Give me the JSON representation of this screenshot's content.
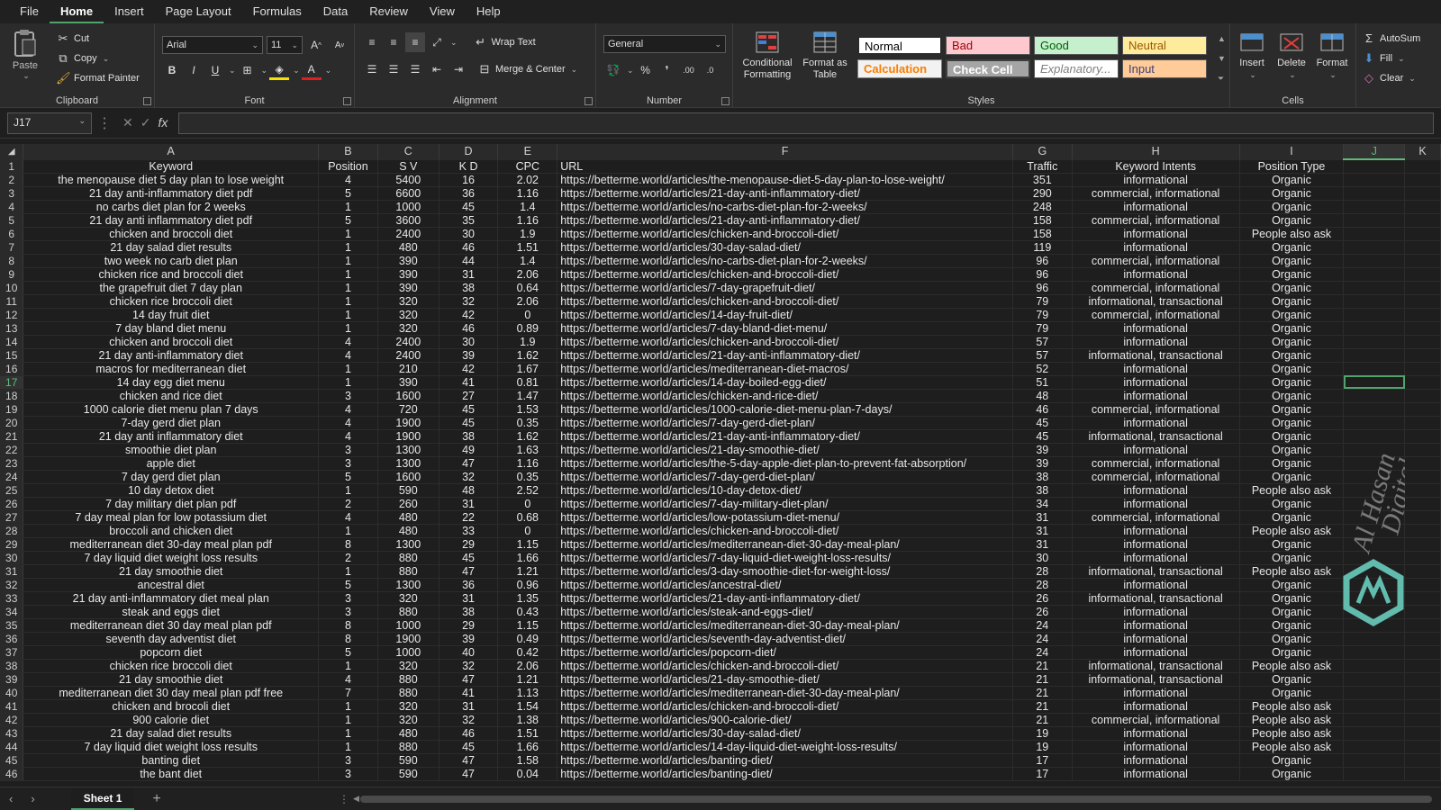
{
  "menu": [
    "File",
    "Home",
    "Insert",
    "Page Layout",
    "Formulas",
    "Data",
    "Review",
    "View",
    "Help"
  ],
  "active_menu": "Home",
  "ribbon": {
    "clipboard": {
      "label": "Clipboard",
      "paste": "Paste",
      "cut": "Cut",
      "copy": "Copy",
      "format_painter": "Format Painter"
    },
    "font": {
      "label": "Font",
      "font_name": "Arial",
      "font_size": "11"
    },
    "alignment": {
      "label": "Alignment",
      "wrap_text": "Wrap Text",
      "merge_center": "Merge & Center"
    },
    "number": {
      "label": "Number",
      "format": "General"
    },
    "styles": {
      "label": "Styles",
      "conditional_formatting": "Conditional Formatting",
      "format_as_table": "Format as Table",
      "cells": [
        {
          "name": "Normal",
          "bg": "#ffffff",
          "fg": "#000000"
        },
        {
          "name": "Bad",
          "bg": "#ffc7ce",
          "fg": "#9c0006"
        },
        {
          "name": "Good",
          "bg": "#c6efce",
          "fg": "#006100"
        },
        {
          "name": "Neutral",
          "bg": "#ffeb9c",
          "fg": "#9c5700"
        },
        {
          "name": "Calculation",
          "bg": "#f2f2f2",
          "fg": "#fa7d00"
        },
        {
          "name": "Check Cell",
          "bg": "#a5a5a5",
          "fg": "#ffffff"
        },
        {
          "name": "Explanatory...",
          "bg": "#ffffff",
          "fg": "#7f7f7f"
        },
        {
          "name": "Input",
          "bg": "#ffcc99",
          "fg": "#3f3f76"
        }
      ]
    },
    "cells": {
      "label": "Cells",
      "insert": "Insert",
      "delete": "Delete",
      "format": "Format"
    },
    "editing": {
      "autosum": "AutoSum",
      "fill": "Fill",
      "clear": "Clear"
    }
  },
  "formula_bar": {
    "name_box": "J17",
    "fx": "fx"
  },
  "columns": [
    "A",
    "B",
    "C",
    "D",
    "E",
    "F",
    "G",
    "H",
    "I",
    "J",
    "K"
  ],
  "selected_column": "J",
  "selected_row": 17,
  "headers": [
    "Keyword",
    "Position",
    "S V",
    "K D",
    "CPC",
    "URL",
    "Traffic",
    "Keyword Intents",
    "Position Type"
  ],
  "rows": [
    [
      "the menopause diet 5 day plan to lose weight",
      "4",
      "5400",
      "16",
      "2.02",
      "https://betterme.world/articles/the-menopause-diet-5-day-plan-to-lose-weight/",
      "351",
      "informational",
      "Organic"
    ],
    [
      "21 day anti-inflammatory diet pdf",
      "5",
      "6600",
      "36",
      "1.16",
      "https://betterme.world/articles/21-day-anti-inflammatory-diet/",
      "290",
      "commercial, informational",
      "Organic"
    ],
    [
      "no carbs diet plan for 2 weeks",
      "1",
      "1000",
      "45",
      "1.4",
      "https://betterme.world/articles/no-carbs-diet-plan-for-2-weeks/",
      "248",
      "informational",
      "Organic"
    ],
    [
      "21 day anti inflammatory diet pdf",
      "5",
      "3600",
      "35",
      "1.16",
      "https://betterme.world/articles/21-day-anti-inflammatory-diet/",
      "158",
      "commercial, informational",
      "Organic"
    ],
    [
      "chicken and broccoli diet",
      "1",
      "2400",
      "30",
      "1.9",
      "https://betterme.world/articles/chicken-and-broccoli-diet/",
      "158",
      "informational",
      "People also ask"
    ],
    [
      "21 day salad diet results",
      "1",
      "480",
      "46",
      "1.51",
      "https://betterme.world/articles/30-day-salad-diet/",
      "119",
      "informational",
      "Organic"
    ],
    [
      "two week no carb diet plan",
      "1",
      "390",
      "44",
      "1.4",
      "https://betterme.world/articles/no-carbs-diet-plan-for-2-weeks/",
      "96",
      "commercial, informational",
      "Organic"
    ],
    [
      "chicken rice and broccoli diet",
      "1",
      "390",
      "31",
      "2.06",
      "https://betterme.world/articles/chicken-and-broccoli-diet/",
      "96",
      "informational",
      "Organic"
    ],
    [
      "the grapefruit diet 7 day plan",
      "1",
      "390",
      "38",
      "0.64",
      "https://betterme.world/articles/7-day-grapefruit-diet/",
      "96",
      "commercial, informational",
      "Organic"
    ],
    [
      "chicken rice broccoli diet",
      "1",
      "320",
      "32",
      "2.06",
      "https://betterme.world/articles/chicken-and-broccoli-diet/",
      "79",
      "informational, transactional",
      "Organic"
    ],
    [
      "14 day fruit diet",
      "1",
      "320",
      "42",
      "0",
      "https://betterme.world/articles/14-day-fruit-diet/",
      "79",
      "commercial, informational",
      "Organic"
    ],
    [
      "7 day bland diet menu",
      "1",
      "320",
      "46",
      "0.89",
      "https://betterme.world/articles/7-day-bland-diet-menu/",
      "79",
      "informational",
      "Organic"
    ],
    [
      "chicken and broccoli diet",
      "4",
      "2400",
      "30",
      "1.9",
      "https://betterme.world/articles/chicken-and-broccoli-diet/",
      "57",
      "informational",
      "Organic"
    ],
    [
      "21 day anti-inflammatory diet",
      "4",
      "2400",
      "39",
      "1.62",
      "https://betterme.world/articles/21-day-anti-inflammatory-diet/",
      "57",
      "informational, transactional",
      "Organic"
    ],
    [
      "macros for mediterranean diet",
      "1",
      "210",
      "42",
      "1.67",
      "https://betterme.world/articles/mediterranean-diet-macros/",
      "52",
      "informational",
      "Organic"
    ],
    [
      "14 day egg diet menu",
      "1",
      "390",
      "41",
      "0.81",
      "https://betterme.world/articles/14-day-boiled-egg-diet/",
      "51",
      "informational",
      "Organic"
    ],
    [
      "chicken and rice diet",
      "3",
      "1600",
      "27",
      "1.47",
      "https://betterme.world/articles/chicken-and-rice-diet/",
      "48",
      "informational",
      "Organic"
    ],
    [
      "1000 calorie diet menu plan 7 days",
      "4",
      "720",
      "45",
      "1.53",
      "https://betterme.world/articles/1000-calorie-diet-menu-plan-7-days/",
      "46",
      "commercial, informational",
      "Organic"
    ],
    [
      "7-day gerd diet plan",
      "4",
      "1900",
      "45",
      "0.35",
      "https://betterme.world/articles/7-day-gerd-diet-plan/",
      "45",
      "informational",
      "Organic"
    ],
    [
      "21 day anti inflammatory diet",
      "4",
      "1900",
      "38",
      "1.62",
      "https://betterme.world/articles/21-day-anti-inflammatory-diet/",
      "45",
      "informational, transactional",
      "Organic"
    ],
    [
      "smoothie diet plan",
      "3",
      "1300",
      "49",
      "1.63",
      "https://betterme.world/articles/21-day-smoothie-diet/",
      "39",
      "informational",
      "Organic"
    ],
    [
      "apple diet",
      "3",
      "1300",
      "47",
      "1.16",
      "https://betterme.world/articles/the-5-day-apple-diet-plan-to-prevent-fat-absorption/",
      "39",
      "commercial, informational",
      "Organic"
    ],
    [
      "7 day gerd diet plan",
      "5",
      "1600",
      "32",
      "0.35",
      "https://betterme.world/articles/7-day-gerd-diet-plan/",
      "38",
      "commercial, informational",
      "Organic"
    ],
    [
      "10 day detox diet",
      "1",
      "590",
      "48",
      "2.52",
      "https://betterme.world/articles/10-day-detox-diet/",
      "38",
      "informational",
      "People also ask"
    ],
    [
      "7 day military diet plan pdf",
      "2",
      "260",
      "31",
      "0",
      "https://betterme.world/articles/7-day-military-diet-plan/",
      "34",
      "informational",
      "Organic"
    ],
    [
      "7 day meal plan for low potassium diet",
      "4",
      "480",
      "22",
      "0.68",
      "https://betterme.world/articles/low-potassium-diet-menu/",
      "31",
      "commercial, informational",
      "Organic"
    ],
    [
      "broccoli and chicken diet",
      "1",
      "480",
      "33",
      "0",
      "https://betterme.world/articles/chicken-and-broccoli-diet/",
      "31",
      "informational",
      "People also ask"
    ],
    [
      "mediterranean diet 30-day meal plan pdf",
      "8",
      "1300",
      "29",
      "1.15",
      "https://betterme.world/articles/mediterranean-diet-30-day-meal-plan/",
      "31",
      "informational",
      "Organic"
    ],
    [
      "7 day liquid diet weight loss results",
      "2",
      "880",
      "45",
      "1.66",
      "https://betterme.world/articles/7-day-liquid-diet-weight-loss-results/",
      "30",
      "informational",
      "Organic"
    ],
    [
      "21 day smoothie diet",
      "1",
      "880",
      "47",
      "1.21",
      "https://betterme.world/articles/3-day-smoothie-diet-for-weight-loss/",
      "28",
      "informational, transactional",
      "People also ask"
    ],
    [
      "ancestral diet",
      "5",
      "1300",
      "36",
      "0.96",
      "https://betterme.world/articles/ancestral-diet/",
      "28",
      "informational",
      "Organic"
    ],
    [
      "21 day anti-inflammatory diet meal plan",
      "3",
      "320",
      "31",
      "1.35",
      "https://betterme.world/articles/21-day-anti-inflammatory-diet/",
      "26",
      "informational, transactional",
      "Organic"
    ],
    [
      "steak and eggs diet",
      "3",
      "880",
      "38",
      "0.43",
      "https://betterme.world/articles/steak-and-eggs-diet/",
      "26",
      "informational",
      "Organic"
    ],
    [
      "mediterranean diet 30 day meal plan pdf",
      "8",
      "1000",
      "29",
      "1.15",
      "https://betterme.world/articles/mediterranean-diet-30-day-meal-plan/",
      "24",
      "informational",
      "Organic"
    ],
    [
      "seventh day adventist diet",
      "8",
      "1900",
      "39",
      "0.49",
      "https://betterme.world/articles/seventh-day-adventist-diet/",
      "24",
      "informational",
      "Organic"
    ],
    [
      "popcorn diet",
      "5",
      "1000",
      "40",
      "0.42",
      "https://betterme.world/articles/popcorn-diet/",
      "24",
      "informational",
      "Organic"
    ],
    [
      "chicken rice broccoli diet",
      "1",
      "320",
      "32",
      "2.06",
      "https://betterme.world/articles/chicken-and-broccoli-diet/",
      "21",
      "informational, transactional",
      "People also ask"
    ],
    [
      "21 day smoothie diet",
      "4",
      "880",
      "47",
      "1.21",
      "https://betterme.world/articles/21-day-smoothie-diet/",
      "21",
      "informational, transactional",
      "Organic"
    ],
    [
      "mediterranean diet 30 day meal plan pdf free",
      "7",
      "880",
      "41",
      "1.13",
      "https://betterme.world/articles/mediterranean-diet-30-day-meal-plan/",
      "21",
      "informational",
      "Organic"
    ],
    [
      "chicken and brocoli diet",
      "1",
      "320",
      "31",
      "1.54",
      "https://betterme.world/articles/chicken-and-broccoli-diet/",
      "21",
      "informational",
      "People also ask"
    ],
    [
      "900 calorie diet",
      "1",
      "320",
      "32",
      "1.38",
      "https://betterme.world/articles/900-calorie-diet/",
      "21",
      "commercial, informational",
      "People also ask"
    ],
    [
      "21 day salad diet results",
      "1",
      "480",
      "46",
      "1.51",
      "https://betterme.world/articles/30-day-salad-diet/",
      "19",
      "informational",
      "People also ask"
    ],
    [
      "7 day liquid diet weight loss results",
      "1",
      "880",
      "45",
      "1.66",
      "https://betterme.world/articles/14-day-liquid-diet-weight-loss-results/",
      "19",
      "informational",
      "People also ask"
    ],
    [
      "banting diet",
      "3",
      "590",
      "47",
      "1.58",
      "https://betterme.world/articles/banting-diet/",
      "17",
      "informational",
      "Organic"
    ],
    [
      "the bant diet",
      "3",
      "590",
      "47",
      "0.04",
      "https://betterme.world/articles/banting-diet/",
      "17",
      "informational",
      "Organic"
    ]
  ],
  "sheet_tab": "Sheet 1",
  "watermark": {
    "line1": "Al Hasan",
    "line2": "Digital"
  }
}
